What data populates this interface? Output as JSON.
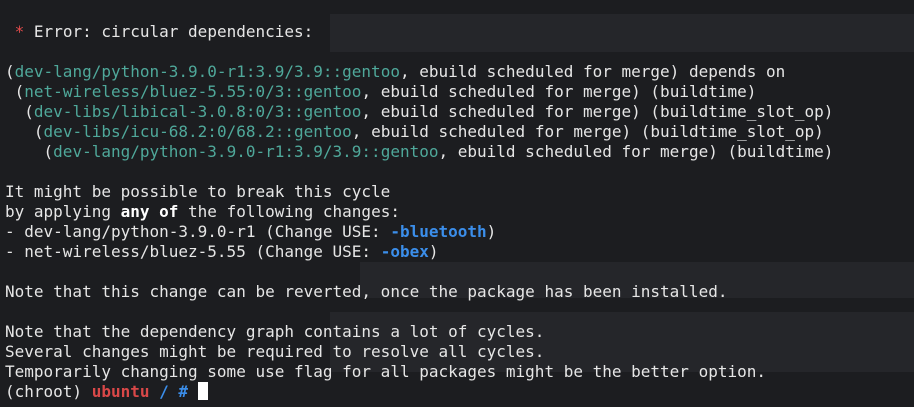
{
  "terminal": {
    "error_star": "*",
    "error_text": "Error: circular dependencies:",
    "deps": [
      {
        "indent": "",
        "open": "(",
        "pkg": "dev-lang/python-3.9.0-r1:3.9/3.9::gentoo",
        "rest": ", ebuild scheduled for merge) depends on"
      },
      {
        "indent": " ",
        "open": "(",
        "pkg": "net-wireless/bluez-5.55:0/3::gentoo",
        "rest": ", ebuild scheduled for merge) (buildtime)"
      },
      {
        "indent": "  ",
        "open": "(",
        "pkg": "dev-libs/libical-3.0.8:0/3::gentoo",
        "rest": ", ebuild scheduled for merge) (buildtime_slot_op)"
      },
      {
        "indent": "   ",
        "open": "(",
        "pkg": "dev-libs/icu-68.2:0/68.2::gentoo",
        "rest": ", ebuild scheduled for merge) (buildtime_slot_op)"
      },
      {
        "indent": "    ",
        "open": "(",
        "pkg": "dev-lang/python-3.9.0-r1:3.9/3.9::gentoo",
        "rest": ", ebuild scheduled for merge) (buildtime)"
      }
    ],
    "break_line1": "It might be possible to break this cycle",
    "break_prefix": "by applying ",
    "break_any": "any",
    "break_of": "of",
    "break_suffix": " the following changes:",
    "changes": [
      {
        "prefix": "- dev-lang/python-3.9.0-r1 (Change USE: ",
        "flag": "-bluetooth",
        "suffix": ")"
      },
      {
        "prefix": "- net-wireless/bluez-5.55 (Change USE: ",
        "flag": "-obex",
        "suffix": ")"
      }
    ],
    "note1": "Note that this change can be reverted, once the package has been installed.",
    "note2": "Note that the dependency graph contains a lot of cycles.",
    "note3": "Several changes might be required to resolve all cycles.",
    "note4": "Temporarily changing some use flag for all packages might be the better option.",
    "prompt": {
      "chroot": "(chroot) ",
      "host": "ubuntu",
      "path": " / ",
      "symbol": "#"
    }
  },
  "colors": {
    "background": "#1c1d20",
    "package": "#4fa89a",
    "flag": "#3b8eea",
    "host": "#d94848",
    "error_star": "#e34b4b"
  }
}
